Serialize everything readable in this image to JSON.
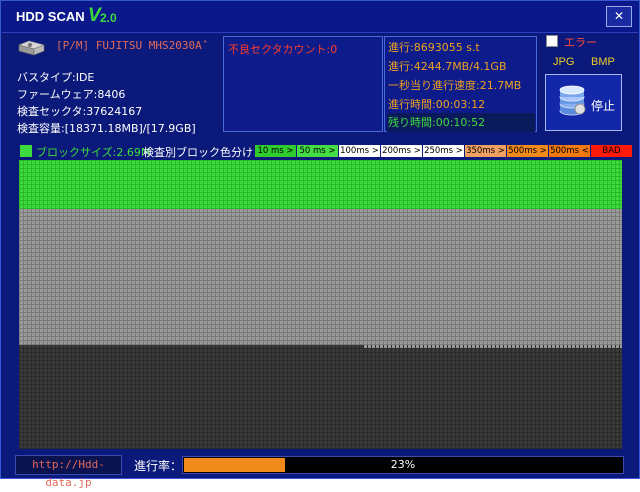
{
  "title": {
    "main": "HDD SCAN",
    "v": "V",
    "version": "2.0",
    "close": "✕"
  },
  "disk": {
    "model": "[P/M] FUJITSU MHS2030Aˆ",
    "bus_type": "バスタイプ:IDE",
    "firmware": "ファームウェア:8406",
    "sectors": "検査セックタ:37624167",
    "capacity": "検査容量:[18371.18MB]/[17.9GB]"
  },
  "bad_sector": "不良セクタカウント:0",
  "stats": {
    "progress_sectors": "進行:8693055 s.t",
    "progress_mb": "進行:4244.7MB/4.1GB",
    "speed": "一秒当り進行速度:21.7MB",
    "elapsed": "進行時間:00:03:12",
    "remaining": "残り時間:00:10:52"
  },
  "options": {
    "error_label": "エラー",
    "error_checked": false,
    "jpg": "JPG",
    "bmp": "BMP",
    "stop": "停止"
  },
  "legend": {
    "block_size": "ブロックサイズ:2.69M",
    "label": "検査別ブロック色分け：",
    "items": [
      {
        "text": "10 ms >",
        "bg": "#2ecc2e",
        "fg": "#000000"
      },
      {
        "text": "50 ms >",
        "bg": "#44dd44",
        "fg": "#000000"
      },
      {
        "text": "100ms >",
        "bg": "#ffffff",
        "fg": "#000000"
      },
      {
        "text": "200ms >",
        "bg": "#ffffff",
        "fg": "#000000"
      },
      {
        "text": "250ms >",
        "bg": "#ffffff",
        "fg": "#000000"
      },
      {
        "text": "350ms >",
        "bg": "#f0a060",
        "fg": "#000000"
      },
      {
        "text": "500ms >",
        "bg": "#f08a1a",
        "fg": "#000000"
      },
      {
        "text": "500ms <",
        "bg": "#f07a10",
        "fg": "#000000"
      },
      {
        "text": "BAD",
        "bg": "#ff1a0a",
        "fg": "#000000"
      }
    ]
  },
  "colors": {
    "scanned_ok": "#3ddc3d",
    "scanned_ok_dark": "#2bb82b",
    "unscanned": "#9a9a9a",
    "unscanned_grid": "#7a7a7a",
    "pending": "#3a3a3a",
    "pending_grid": "#2a2a2a"
  },
  "scan_map": {
    "green_fraction": 0.23,
    "scan_progress": 0.23
  },
  "footer": {
    "url": "http://Hdd-data.jp",
    "progress_label": "進行率：",
    "progress_value": 0.23,
    "progress_text": "23%"
  }
}
